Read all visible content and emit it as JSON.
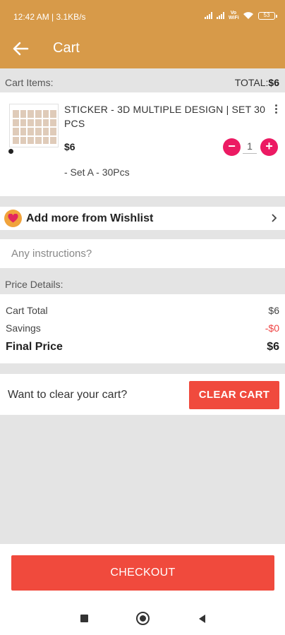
{
  "status": {
    "time": "12:42 AM",
    "speed": "3.1KB/s",
    "network_label": "Vo\nWiFi",
    "battery": "53"
  },
  "appbar": {
    "title": "Cart"
  },
  "cart": {
    "label": "Cart Items:",
    "total_prefix": "TOTAL:",
    "total_value": "$6"
  },
  "product": {
    "name": "STICKER - 3D MULTIPLE DESIGN | SET 30 PCS",
    "price": "$6",
    "quantity": "1",
    "variant": "- Set A - 30Pcs"
  },
  "wishlist": {
    "label": "Add more from Wishlist"
  },
  "instructions": {
    "placeholder": "Any instructions?"
  },
  "price_details": {
    "heading": "Price Details:",
    "rows": [
      {
        "label": "Cart Total",
        "value": "$6"
      },
      {
        "label": "Savings",
        "value": "-$0"
      },
      {
        "label": "Final Price",
        "value": "$6"
      }
    ]
  },
  "clear": {
    "prompt": "Want to clear your cart?",
    "button": "CLEAR CART"
  },
  "checkout": {
    "button": "CHECKOUT"
  },
  "colors": {
    "appbar": "#d79a49",
    "accent": "#ec1a63",
    "button": "#f04a3d"
  }
}
